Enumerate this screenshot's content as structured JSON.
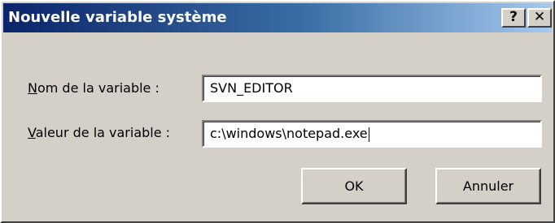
{
  "window": {
    "title": "Nouvelle variable système",
    "help_icon": "?",
    "close_icon": "✕"
  },
  "form": {
    "name_label_mnemonic": "N",
    "name_label_rest": "om de la variable :",
    "name_value": "SVN_EDITOR",
    "value_label_mnemonic": "V",
    "value_label_rest": "aleur de la variable :",
    "value_value": "c:\\windows\\notepad.exe"
  },
  "buttons": {
    "ok_label": "OK",
    "cancel_label": "Annuler"
  }
}
